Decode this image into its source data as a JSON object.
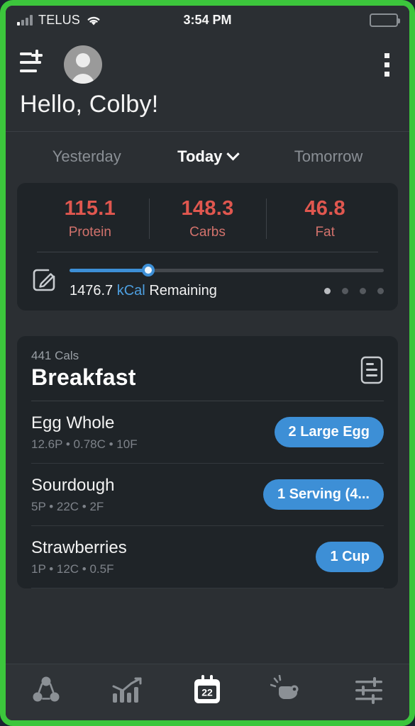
{
  "status_bar": {
    "carrier": "TELUS",
    "time": "3:54 PM",
    "signal_icon": "signal-bars-icon",
    "wifi_icon": "wifi-icon",
    "battery_icon": "battery-low-icon",
    "battery_color": "#e0342c"
  },
  "header": {
    "menu_icon": "menu-add-icon",
    "avatar_icon": "avatar-placeholder-icon",
    "kebab_icon": "more-options-icon",
    "greeting": "Hello, Colby!"
  },
  "day_selector": {
    "previous": "Yesterday",
    "current": "Today",
    "next": "Tomorrow",
    "dropdown_icon": "chevron-down-icon"
  },
  "macro_card": {
    "macros": [
      {
        "value": "115.1",
        "label": "Protein"
      },
      {
        "value": "148.3",
        "label": "Carbs"
      },
      {
        "value": "46.8",
        "label": "Fat"
      }
    ],
    "accent_color": "#e0574f",
    "edit_icon": "edit-pencil-icon",
    "calories_remaining": "1476.7",
    "calories_unit": "kCal",
    "calories_suffix": "Remaining",
    "slider_percent": 25,
    "slider_color": "#3d8fd6",
    "page_dots": 4,
    "active_dot": 1
  },
  "meal": {
    "calories": "441 Cals",
    "title": "Breakfast",
    "note_icon": "note-document-icon",
    "items": [
      {
        "name": "Egg Whole",
        "macros": "12.6P  •  0.78C  •  10F",
        "serving": "2 Large Egg"
      },
      {
        "name": "Sourdough",
        "macros": "5P  •  22C  •  2F",
        "serving": "1 Serving (4..."
      },
      {
        "name": "Strawberries",
        "macros": "1P  •  12C  •  0.5F",
        "serving": "1 Cup"
      }
    ]
  },
  "bottom_nav": {
    "items": [
      {
        "icon": "share-circles-icon",
        "active": false
      },
      {
        "icon": "bar-chart-trend-icon",
        "active": false
      },
      {
        "icon": "calendar-icon",
        "label": "22",
        "active": true
      },
      {
        "icon": "whistle-icon",
        "active": false
      },
      {
        "icon": "sliders-settings-icon",
        "active": false
      }
    ]
  }
}
